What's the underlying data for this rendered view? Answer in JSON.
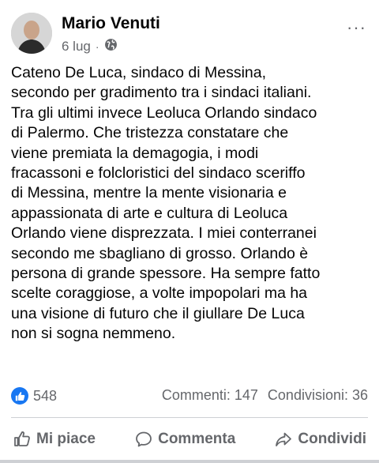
{
  "post": {
    "author_name": "Mario Venuti",
    "date": "6 lug",
    "separator": "·",
    "audience_icon": "globe-icon",
    "more_label": "···",
    "text": "Cateno De Luca, sindaco di Messina,\nsecondo per gradimento tra i sindaci italiani.\nTra gli ultimi invece Leoluca Orlando sindaco\ndi Palermo. Che tristezza constatare che\nviene premiata la demagogia, i modi\nfracassoni e folcloristici del sindaco sceriffo\ndi Messina, mentre la mente visionaria e\nappassionata di arte e cultura di Leoluca\nOrlando viene disprezzata. I miei conterranei\nsecondo me sbagliano di grosso. Orlando è\npersona di grande spessore. Ha sempre fatto\nscelte coraggiose, a volte impopolari ma ha\nuna visione di futuro che il giullare De Luca\nnon si sogna nemmeno."
  },
  "stats": {
    "reaction_count": "548",
    "comments": "Commenti: 147",
    "shares": "Condivisioni: 36"
  },
  "actions": {
    "like_label": "Mi piace",
    "comment_label": "Commenta",
    "share_label": "Condividi"
  },
  "colors": {
    "accent": "#1877f2",
    "secondary_text": "#65676b",
    "divider": "#ced0d4"
  }
}
